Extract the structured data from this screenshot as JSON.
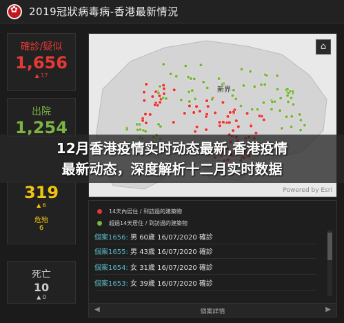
{
  "header": {
    "title": "2019冠狀病毒病-香港最新情況"
  },
  "stats": {
    "confirmed": {
      "label": "確診/疑似",
      "value": "1,656",
      "delta": "▲ 17"
    },
    "discharged": {
      "label": "出院",
      "value": "1,254"
    },
    "hospital": {
      "value": "319",
      "delta": "▲ 6",
      "critical_label": "危殆",
      "critical_value": "6"
    },
    "deaths": {
      "label": "死亡",
      "value": "10",
      "delta": "▲ 0"
    }
  },
  "map": {
    "region_label": "新界",
    "powered_by": "Powered by Esri",
    "home_icon": "home-icon"
  },
  "legend": [
    {
      "color": "#e53935",
      "label": "14天內居住 / 到訪過的建築物"
    },
    {
      "color": "#7cb342",
      "label": "超過14天居住 / 到訪過的建築物"
    }
  ],
  "cases": [
    {
      "id": "個案1656:",
      "text": "男  60歲  16/07/2020 確診"
    },
    {
      "id": "個案1655:",
      "text": "男  43歲  16/07/2020 確診"
    },
    {
      "id": "個案1654:",
      "text": "女  31歲  16/07/2020 確診"
    },
    {
      "id": "個案1653:",
      "text": "女  39歲  16/07/2020 確診"
    }
  ],
  "pager": {
    "label": "個案詳情",
    "prev": "◀",
    "next": "▶"
  },
  "overlay": {
    "line1": "12月香港疫情实时动态最新,香港疫情",
    "line2": "最新动态，深度解析十二月实时数据"
  }
}
